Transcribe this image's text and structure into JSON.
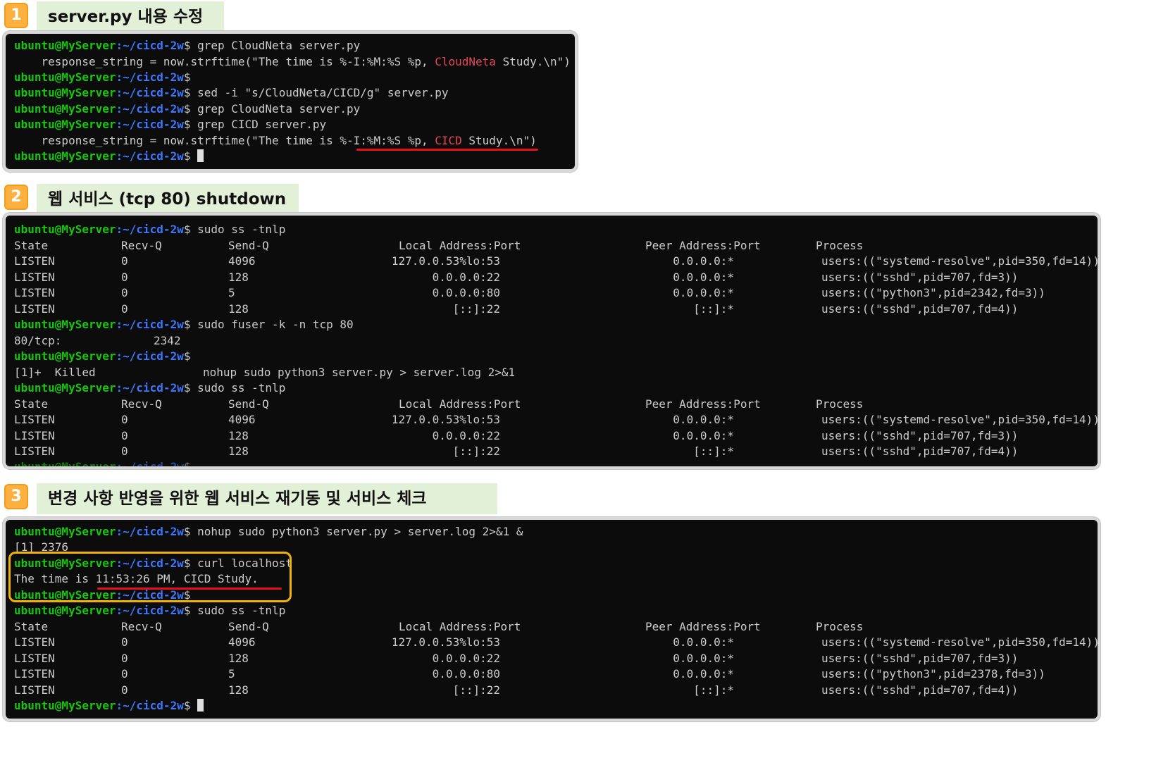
{
  "prompt": {
    "user": "ubuntu@MyServer",
    "path": ":~/cicd-2w",
    "dollar": "$ "
  },
  "sections": [
    {
      "num": "1",
      "title": "server.py 내용 수정"
    },
    {
      "num": "2",
      "title": "웹 서비스 (tcp 80) shutdown"
    },
    {
      "num": "3",
      "title": "변경 사항 반영을 위한 웹 서비스 재기동 및 서비스 체크"
    }
  ],
  "term1": {
    "cmd_grep_cloudneta": "grep CloudNeta server.py",
    "resp1_pre": "    response_string = now.strftime(\"The time is %-I:%M:%S %p, ",
    "resp1_red": "CloudNeta",
    "resp1_post": " Study.\\n\")",
    "cmd_sed": "sed -i \"s/CloudNeta/CICD/g\" server.py",
    "cmd_grep_cicd": "grep CICD server.py",
    "resp2_pre": "    response_string = now.strftime(\"The time is %-I:%M:%S %p, ",
    "resp2_red": "CICD",
    "resp2_post": " Study.\\n\")"
  },
  "ss_header": [
    "State",
    "Recv-Q",
    "Send-Q",
    "Local Address:Port",
    "Peer Address:Port",
    "Process"
  ],
  "ss_rows_full": [
    [
      "LISTEN",
      "0",
      "4096",
      "127.0.0.53%lo:53",
      "0.0.0.0:*",
      "users:((\"systemd-resolve\",pid=350,fd=14))"
    ],
    [
      "LISTEN",
      "0",
      "128",
      "0.0.0.0:22",
      "0.0.0.0:*",
      "users:((\"sshd\",pid=707,fd=3))"
    ],
    [
      "LISTEN",
      "0",
      "5",
      "0.0.0.0:80",
      "0.0.0.0:*",
      "users:((\"python3\",pid=2342,fd=3))"
    ],
    [
      "LISTEN",
      "0",
      "128",
      "[::]:22",
      "[::]:*",
      "users:((\"sshd\",pid=707,fd=4))"
    ]
  ],
  "ss_rows_after_kill": [
    [
      "LISTEN",
      "0",
      "4096",
      "127.0.0.53%lo:53",
      "0.0.0.0:*",
      "users:((\"systemd-resolve\",pid=350,fd=14))"
    ],
    [
      "LISTEN",
      "0",
      "128",
      "0.0.0.0:22",
      "0.0.0.0:*",
      "users:((\"sshd\",pid=707,fd=3))"
    ],
    [
      "LISTEN",
      "0",
      "128",
      "[::]:22",
      "[::]:*",
      "users:((\"sshd\",pid=707,fd=4))"
    ]
  ],
  "ss_rows_restart": [
    [
      "LISTEN",
      "0",
      "4096",
      "127.0.0.53%lo:53",
      "0.0.0.0:*",
      "users:((\"systemd-resolve\",pid=350,fd=14))"
    ],
    [
      "LISTEN",
      "0",
      "128",
      "0.0.0.0:22",
      "0.0.0.0:*",
      "users:((\"sshd\",pid=707,fd=3))"
    ],
    [
      "LISTEN",
      "0",
      "5",
      "0.0.0.0:80",
      "0.0.0.0:*",
      "users:((\"python3\",pid=2378,fd=3))"
    ],
    [
      "LISTEN",
      "0",
      "128",
      "[::]:22",
      "[::]:*",
      "users:((\"sshd\",pid=707,fd=4))"
    ]
  ],
  "term2": {
    "cmd_ss": "sudo ss -tnlp",
    "cmd_fuser": "sudo fuser -k -n tcp 80",
    "fuser_out_port": "80/tcp:",
    "fuser_out_pid": "2342",
    "killed_job": "[1]+  Killed",
    "killed_cmd": "nohup sudo python3 server.py > server.log 2>&1"
  },
  "term3": {
    "cmd_nohup": "nohup sudo python3 server.py > server.log 2>&1 &",
    "job_out": "[1] 2376",
    "cmd_curl": "curl localhost",
    "curl_out": "The time is 11:53:26 PM, CICD Study.",
    "cmd_ss": "sudo ss -tnlp"
  },
  "colors": {
    "badge": "#fbb040",
    "title_bg": "#e3f0d8",
    "terminal_bg": "#0c0c0c",
    "prompt_user": "#16c60c",
    "prompt_path": "#3b78ff",
    "highlight_red": "#e74856",
    "underline_red": "#e8101a",
    "highlight_box": "#f0b300"
  }
}
